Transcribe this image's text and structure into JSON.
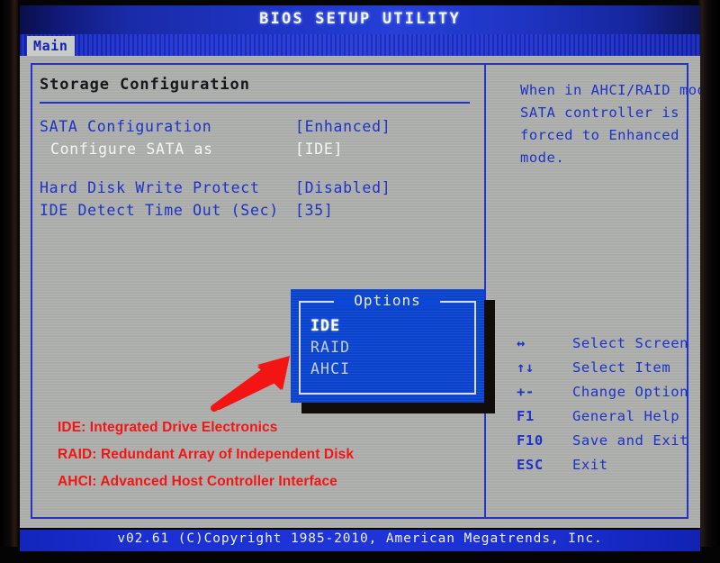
{
  "window": {
    "title": "BIOS SETUP UTILITY"
  },
  "tabs": [
    {
      "label": "Main",
      "active": true
    }
  ],
  "main": {
    "section_title": "Storage Configuration",
    "settings": [
      {
        "label": "SATA Configuration",
        "value": "[Enhanced]",
        "selected": false,
        "indent": false
      },
      {
        "label": "Configure SATA as",
        "value": "[IDE]",
        "selected": true,
        "indent": true
      },
      {
        "label": "Hard Disk Write Protect",
        "value": "[Disabled]",
        "selected": false,
        "indent": false
      },
      {
        "label": "IDE Detect Time Out (Sec)",
        "value": "[35]",
        "selected": false,
        "indent": false
      }
    ]
  },
  "options_dialog": {
    "title": "Options",
    "items": [
      {
        "label": "IDE",
        "selected": true
      },
      {
        "label": "RAID",
        "selected": false
      },
      {
        "label": "AHCI",
        "selected": false
      }
    ]
  },
  "help": {
    "lines": [
      "When in AHCI/RAID mode",
      "SATA controller is",
      "forced to Enhanced",
      "mode."
    ]
  },
  "key_legend": [
    {
      "key": "↔",
      "desc": "Select Screen"
    },
    {
      "key": "↑↓",
      "desc": "Select Item"
    },
    {
      "key": "+-",
      "desc": "Change Option"
    },
    {
      "key": "F1",
      "desc": "General Help"
    },
    {
      "key": "F10",
      "desc": "Save and Exit"
    },
    {
      "key": "ESC",
      "desc": "Exit"
    }
  ],
  "footer": {
    "text": "v02.61 (C)Copyright 1985-2010, American Megatrends, Inc."
  },
  "annotations": {
    "legend_lines": [
      "IDE:  Integrated Drive Electronics",
      "RAID: Redundant Array of Independent Disk",
      "AHCI: Advanced Host Controller Interface"
    ],
    "arrow_color": "#f31414"
  },
  "colors": {
    "console_gray": "#b0b1af",
    "bios_blue": "#1b33c6",
    "dialog_blue": "#0b46d4",
    "title_band": "#1e34c4",
    "annotation_red": "#f31414",
    "selected_text": "#f4f5f7"
  }
}
